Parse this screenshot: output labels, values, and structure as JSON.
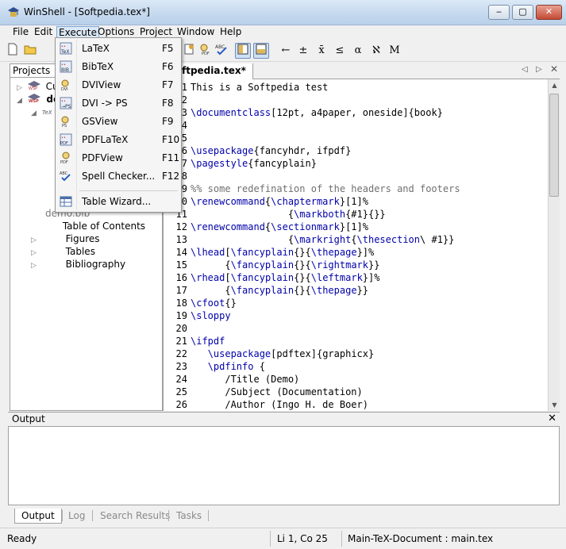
{
  "window": {
    "title": "WinShell - [Softpedia.tex*]",
    "min": "‒",
    "max": "▢",
    "close": "✕"
  },
  "menu": [
    "File",
    "Edit",
    "Execute",
    "Options",
    "Project",
    "Window",
    "Help"
  ],
  "toolbar_symbols": [
    "←",
    "±",
    "x̄",
    "≤",
    "α",
    "ℵ",
    "M"
  ],
  "projects": {
    "tab": "Projects",
    "items": [
      {
        "label": "Cu",
        "icon": "wsp-icon"
      },
      {
        "label": "de",
        "icon": "wsp-icon"
      },
      {
        "label": "demo.bib",
        "icon": "bib-icon"
      },
      {
        "label": "Table of Contents"
      },
      {
        "label": "Figures"
      },
      {
        "label": "Tables"
      },
      {
        "label": "Bibliography"
      }
    ]
  },
  "editor": {
    "tab": "ftpedia.tex*",
    "lines": [
      {
        "n": "1",
        "t": "This is a Softpedia test"
      },
      {
        "n": "2",
        "t": ""
      },
      {
        "n": "3",
        "t": "\\documentclass[12pt, a4paper, oneside]{book}"
      },
      {
        "n": "4",
        "t": ""
      },
      {
        "n": "5",
        "t": ""
      },
      {
        "n": "6",
        "t": "\\usepackage{fancyhdr, ifpdf}"
      },
      {
        "n": "7",
        "t": "\\pagestyle{fancyplain}"
      },
      {
        "n": "8",
        "t": ""
      },
      {
        "n": "9",
        "t": "%% some redefination of the headers and footers"
      },
      {
        "n": "10",
        "t": "\\renewcommand{\\chaptermark}[1]%"
      },
      {
        "n": "11",
        "t": "                 {\\markboth{#1}{}}"
      },
      {
        "n": "12",
        "t": "\\renewcommand{\\sectionmark}[1]%"
      },
      {
        "n": "13",
        "t": "                 {\\markright{\\thesection\\ #1}}"
      },
      {
        "n": "14",
        "t": "\\lhead[\\fancyplain{}{\\thepage}]%"
      },
      {
        "n": "15",
        "t": "      {\\fancyplain{}{\\rightmark}}"
      },
      {
        "n": "16",
        "t": "\\rhead[\\fancyplain{}{\\leftmark}]%"
      },
      {
        "n": "17",
        "t": "      {\\fancyplain{}{\\thepage}}"
      },
      {
        "n": "18",
        "t": "\\cfoot{}"
      },
      {
        "n": "19",
        "t": "\\sloppy"
      },
      {
        "n": "20",
        "t": ""
      },
      {
        "n": "21",
        "t": "\\ifpdf"
      },
      {
        "n": "22",
        "t": "   \\usepackage[pdftex]{graphicx}"
      },
      {
        "n": "23",
        "t": "   \\pdfinfo {"
      },
      {
        "n": "24",
        "t": "      /Title (Demo)"
      },
      {
        "n": "25",
        "t": "      /Subject (Documentation)"
      },
      {
        "n": "26",
        "t": "      /Author (Ingo H. de Boer)"
      }
    ]
  },
  "execute_menu": [
    {
      "label": "LaTeX",
      "key": "F5",
      "icon": "latex-icon"
    },
    {
      "label": "BibTeX",
      "key": "F6",
      "icon": "bibtex-icon"
    },
    {
      "label": "DVIView",
      "key": "F7",
      "icon": "dviview-icon"
    },
    {
      "label": "DVI -> PS",
      "key": "F8",
      "icon": "dvi-ps-icon"
    },
    {
      "label": "GSView",
      "key": "F9",
      "icon": "gsview-icon"
    },
    {
      "label": "PDFLaTeX",
      "key": "F10",
      "icon": "pdflatex-icon"
    },
    {
      "label": "PDFView",
      "key": "F11",
      "icon": "pdfview-icon"
    },
    {
      "label": "Spell Checker...",
      "key": "F12",
      "icon": "spell-check-icon"
    },
    {
      "label": "Table Wizard...",
      "key": "",
      "icon": "table-wizard-icon"
    }
  ],
  "output": {
    "title": "Output",
    "close": "✕",
    "tabs": [
      "Output",
      "Log",
      "Search Results",
      "Tasks"
    ]
  },
  "status": {
    "state": "Ready",
    "position": "Li 1, Co 25",
    "document": "Main-TeX-Document : main.tex"
  }
}
